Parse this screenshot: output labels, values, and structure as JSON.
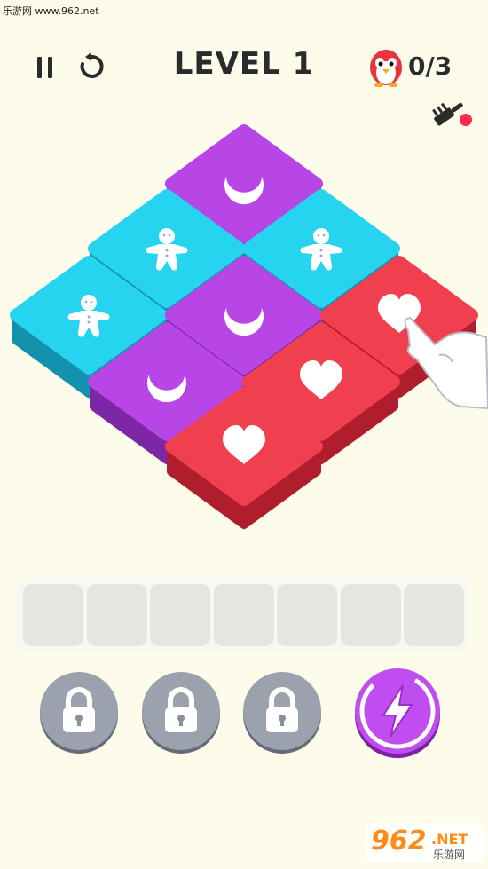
{
  "watermark_top": "乐游网 www.962.net",
  "header": {
    "level_title": "LEVEL 1",
    "progress_count": "0/3",
    "pause_icon": "pause-icon",
    "restart_icon": "restart-icon",
    "avatar_icon": "penguin-icon",
    "tool_icon": "brush-icon",
    "notification_color": "#ff2b4a"
  },
  "tiles": [
    {
      "symbol": "moon",
      "color": "#b845e6"
    },
    {
      "symbol": "gingerbread",
      "color": "#26d4ef"
    },
    {
      "symbol": "gingerbread",
      "color": "#26d4ef"
    },
    {
      "symbol": "gingerbread",
      "color": "#26d4ef"
    },
    {
      "symbol": "moon",
      "color": "#b845e6"
    },
    {
      "symbol": "heart",
      "color": "#f0404f"
    },
    {
      "symbol": "moon",
      "color": "#b845e6"
    },
    {
      "symbol": "heart",
      "color": "#f0404f"
    },
    {
      "symbol": "heart",
      "color": "#f0404f"
    }
  ],
  "tray": {
    "slot_count": 7
  },
  "powerups": [
    {
      "name": "locked-powerup-1",
      "icon": "lock-icon",
      "locked": true
    },
    {
      "name": "locked-powerup-2",
      "icon": "lock-icon",
      "locked": true
    },
    {
      "name": "locked-powerup-3",
      "icon": "lock-icon",
      "locked": true
    },
    {
      "name": "lightning-powerup",
      "icon": "lightning-icon",
      "locked": false
    }
  ],
  "watermark_bottom": {
    "number": "962",
    "suffix": ".NET",
    "caption": "乐游网"
  }
}
